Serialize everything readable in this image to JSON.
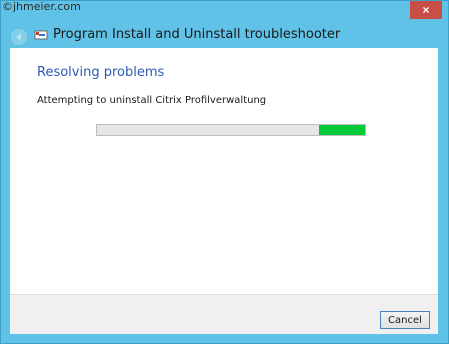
{
  "watermark": "©jhmeier.com",
  "window": {
    "title": "Program Install and Uninstall troubleshooter",
    "close_symbol": "×"
  },
  "content": {
    "heading": "Resolving problems",
    "status": "Attempting to uninstall Citrix Profilverwaltung"
  },
  "progress": {
    "chunk_start": 0.83,
    "chunk_end": 1.0,
    "fill_color": "#06c93a"
  },
  "footer": {
    "cancel_label": "Cancel"
  }
}
